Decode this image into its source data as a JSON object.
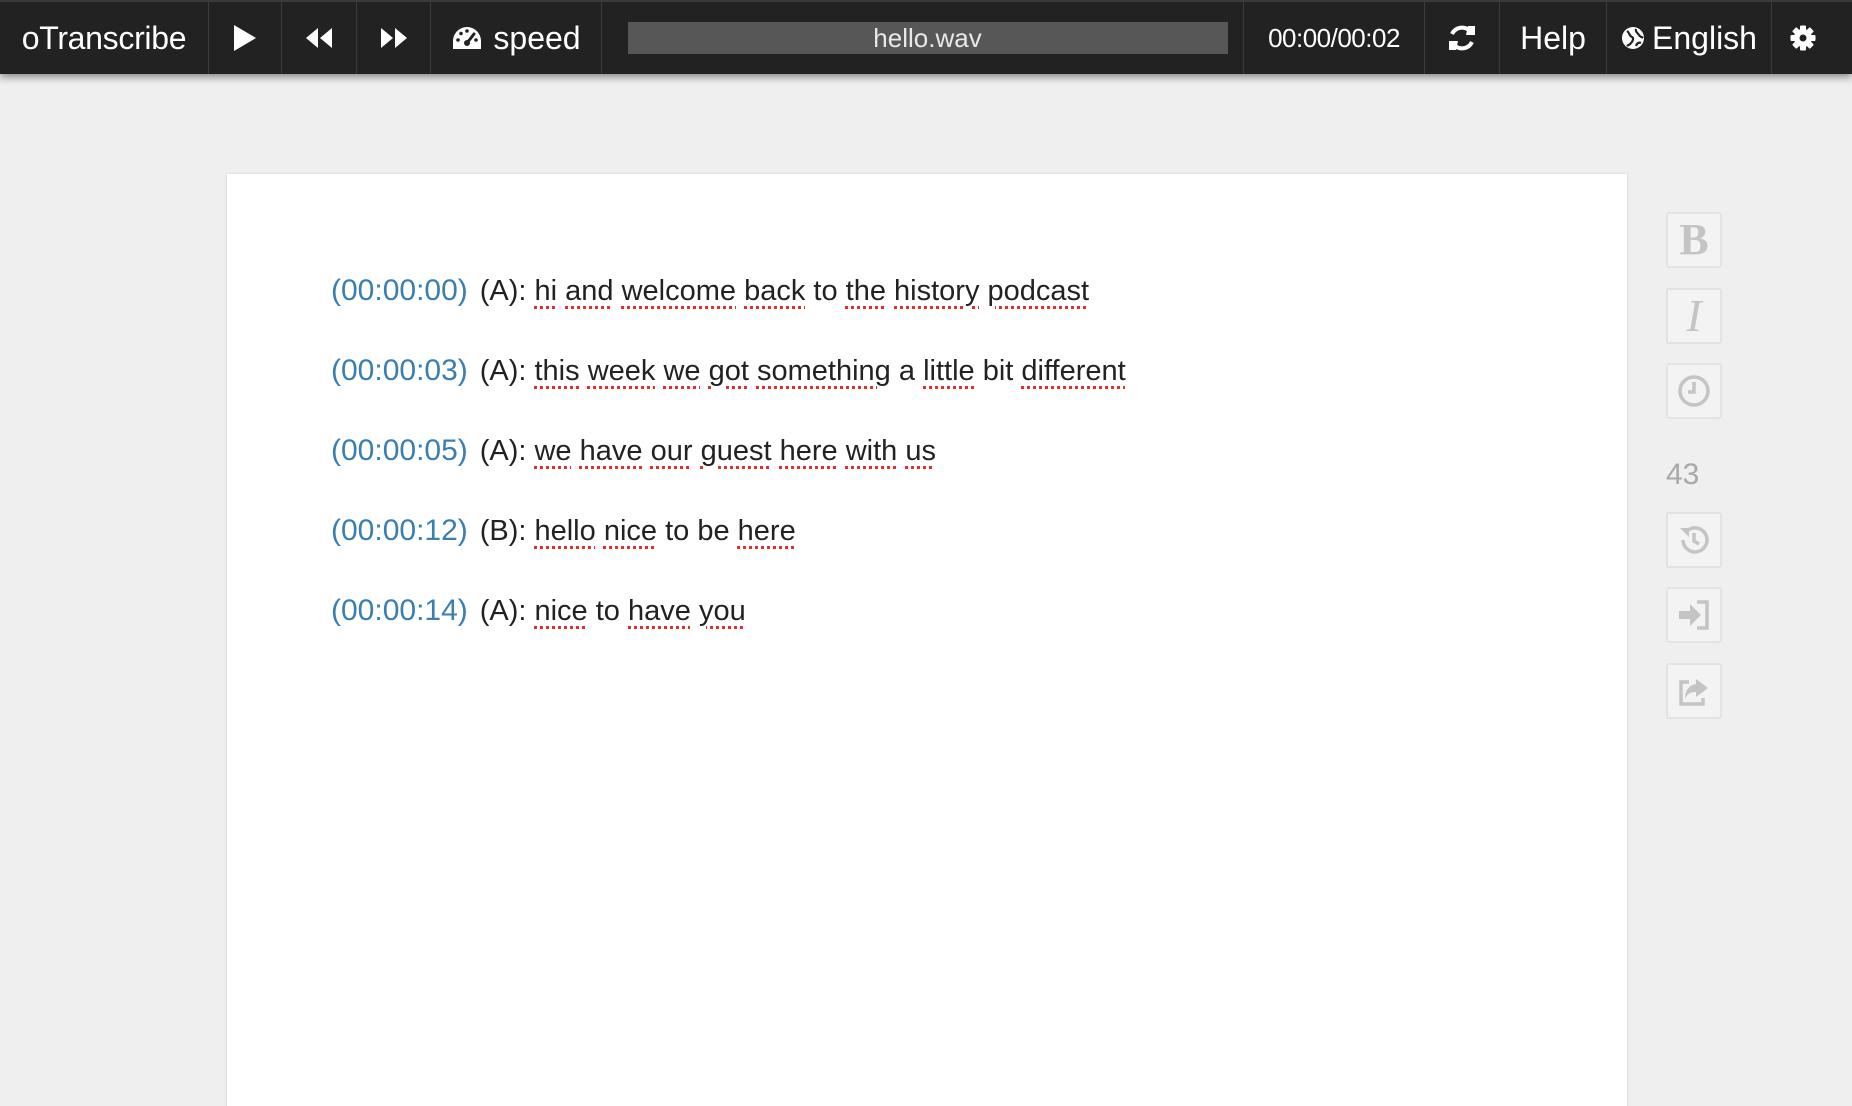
{
  "app": {
    "brand": "oTranscribe"
  },
  "toolbar": {
    "play_icon": "play-icon",
    "rewind_icon": "rewind-icon",
    "fast_forward_icon": "fast-forward-icon",
    "speed_label": "speed",
    "file_name": "hello.wav",
    "time_display": "00:00/00:02",
    "reset_icon": "refresh-icon",
    "help_label": "Help",
    "language_label": "English",
    "settings_icon": "gear-icon"
  },
  "transcript": {
    "lines": [
      {
        "timestamp": "(00:00:00)",
        "speaker": "(A):",
        "words": [
          "hi",
          "and",
          "welcome",
          "back",
          "to",
          "the",
          "history",
          "podcast"
        ]
      },
      {
        "timestamp": "(00:00:03)",
        "speaker": "(A):",
        "words": [
          "this",
          "week",
          "we",
          "got",
          "something",
          "a",
          "little",
          "bit",
          "different"
        ]
      },
      {
        "timestamp": "(00:00:05)",
        "speaker": "(A):",
        "words": [
          "we",
          "have",
          "our",
          "guest",
          "here",
          "with",
          "us"
        ]
      },
      {
        "timestamp": "(00:00:12)",
        "speaker": "(B):",
        "words": [
          "hello",
          "nice",
          "to",
          "be",
          "here"
        ]
      },
      {
        "timestamp": "(00:00:14)",
        "speaker": "(A):",
        "words": [
          "nice",
          "to",
          "have",
          "you"
        ]
      }
    ]
  },
  "sidebar": {
    "bold_label": "B",
    "italic_label": "I",
    "timestamp_icon": "clock-icon",
    "word_count": "43",
    "history_icon": "history-icon",
    "import_icon": "import-icon",
    "export_icon": "export-icon"
  },
  "colors": {
    "topbar_bg": "#222222",
    "timestamp": "#3a7fb0",
    "spellcheck": "#e0302a",
    "page_bg": "#efefef"
  }
}
